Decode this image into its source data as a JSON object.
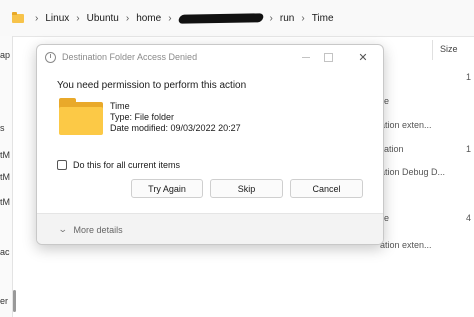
{
  "breadcrumb": {
    "items": [
      "Linux",
      "Ubuntu",
      "home",
      "run",
      "Time"
    ]
  },
  "columns": {
    "size_label": "Size"
  },
  "background": {
    "row_texts": [
      "ile",
      "ation exten...",
      "ation Debug D...",
      "ile",
      "ation exten..."
    ],
    "size_values": [
      "1",
      "1",
      "4"
    ],
    "left_fragments": [
      "ap",
      "s",
      "tM",
      "tM",
      "tM",
      "ac",
      "er"
    ]
  },
  "dialog": {
    "title": "Destination Folder Access Denied",
    "message": "You need permission to perform this action",
    "file": {
      "name": "Time",
      "type": "Type: File folder",
      "modified": "Date modified: 09/03/2022 20:27"
    },
    "checkbox_label": "Do this for all current items",
    "buttons": {
      "try_again": "Try Again",
      "skip": "Skip",
      "cancel": "Cancel"
    },
    "more_details": "More details"
  },
  "colors": {
    "folder_front": "#fcc946",
    "folder_back": "#e9a92a"
  }
}
